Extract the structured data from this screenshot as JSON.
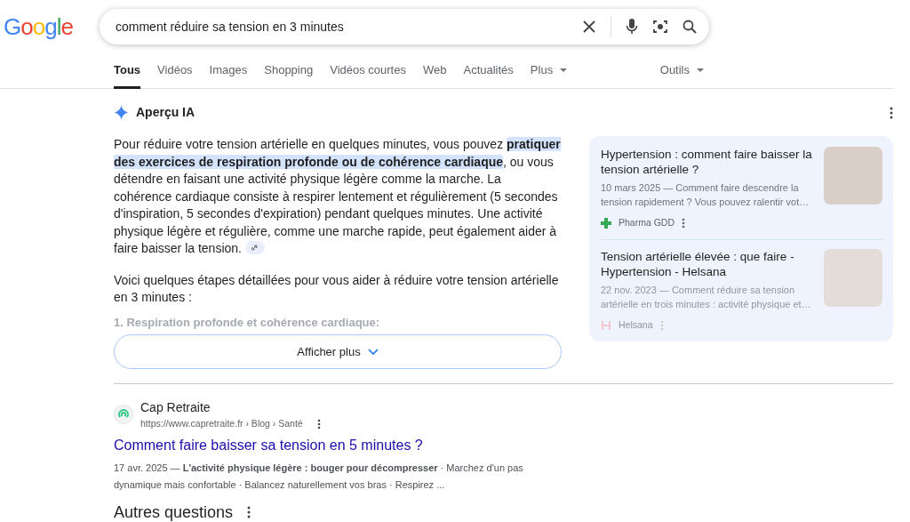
{
  "search": {
    "logo": "Google",
    "query": "comment réduire sa tension en 3 minutes"
  },
  "tabs": [
    {
      "label": "Tous",
      "selected": true,
      "kind": "link"
    },
    {
      "label": "Vidéos",
      "selected": false,
      "kind": "link"
    },
    {
      "label": "Images",
      "selected": false,
      "kind": "link"
    },
    {
      "label": "Shopping",
      "selected": false,
      "kind": "link"
    },
    {
      "label": "Vidéos courtes",
      "selected": false,
      "kind": "link"
    },
    {
      "label": "Web",
      "selected": false,
      "kind": "link"
    },
    {
      "label": "Actualités",
      "selected": false,
      "kind": "link"
    },
    {
      "label": "Plus",
      "selected": false,
      "kind": "menu"
    }
  ],
  "tools": "Outils",
  "ai_overview": {
    "title": "Aperçu IA",
    "paragraph": "Pour réduire votre tension artérielle en quelques minutes, vous pouvez **pratiquer des exercices de respiration profonde ou de cohérence cardiaque**, ou vous détendre en faisant une activité physique légère comme la marche. La cohérence cardiaque consiste à respirer lentement et régulièrement (5 secondes d'inspiration, 5 secondes d'expiration) pendant quelques minutes. Une activité physique légère et régulière, comme une marche rapide, peut également aider à faire baisser la tension.",
    "intro": "Voici quelques étapes détaillées pour vous aider à réduire votre tension artérielle en 3 minutes :",
    "faded_step": "1. Respiration profonde et cohérence cardiaque:",
    "show_more": "Afficher plus",
    "sources": [
      {
        "title": "Hypertension : comment faire baisser la tension artérielle ?",
        "snippet": "10 mars 2025 — Comment faire descendre la tension rapidement ? Vous pouvez ralentir vot…",
        "source": "Pharma GDD",
        "faded": false
      },
      {
        "title": "Tension artérielle élevée : que faire - Hypertension - Helsana",
        "snippet": "22 nov. 2023 — Comment réduire sa tension artérielle en trois minutes : activité physique et…",
        "source": "Helsana",
        "faded": true
      }
    ]
  },
  "results": [
    {
      "site": "Cap Retraite",
      "url": "https://www.capretraite.fr › Blog › Santé",
      "title": "Comment faire baisser sa tension en 5 minutes ?",
      "snippet": "17 avr. 2025 — **L'activité physique légère : bouger pour décompresser** · Marchez d'un pas dynamique mais confortable · Balancez naturellement vos bras · Respirez ..."
    }
  ],
  "other_questions": "Autres questions"
}
